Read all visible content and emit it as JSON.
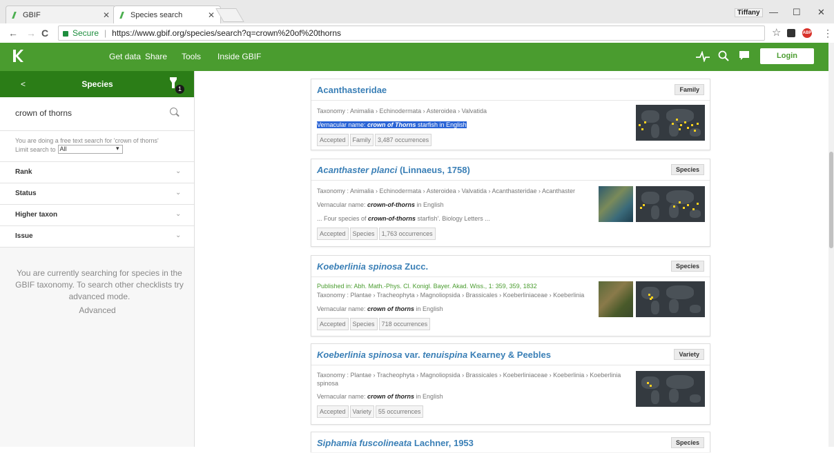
{
  "browser": {
    "tabs": [
      {
        "title": "GBIF"
      },
      {
        "title": "Species search"
      }
    ],
    "profile_name": "Tiffany",
    "window_controls": {
      "minimize": "—",
      "maximize": "☐",
      "close": "✕"
    },
    "nav": {
      "back": "←",
      "forward": "→",
      "reload": "C"
    },
    "security_label": "Secure",
    "url": "https://www.gbif.org/species/search?q=crown%20of%20thorns",
    "extension_abp": "ABP"
  },
  "gbif_nav": {
    "items": [
      "Get data",
      "Share",
      "Tools",
      "Inside GBIF"
    ],
    "login_label": "Login",
    "brand_color": "#4a9c2f"
  },
  "sidebar": {
    "back": "<",
    "title": "Species",
    "filter_count": "1",
    "search_value": "crown of thorns",
    "freetext_note": "You are doing a free text search for 'crown of thorns'",
    "limit_label": "Limit search to",
    "limit_value": "All",
    "facets": [
      "Rank",
      "Status",
      "Higher taxon",
      "Issue"
    ],
    "info_text": "You are currently searching for species in the GBIF taxonomy. To search other checklists try advanced mode.",
    "advanced_label": "Advanced"
  },
  "results": [
    {
      "name": "Acanthasteridae",
      "author": "",
      "rank": "Family",
      "published": "",
      "taxonomy": "Taxonomy : Animalia › Echinodermata › Asteroidea › Valvatida",
      "vernacular_prefix": "Vernacular name: ",
      "vernacular_name": "crown of Thorns",
      "vernacular_suffix": " starfish in English",
      "snippet_prefix": "",
      "snippet_bold": "",
      "snippet_suffix": "",
      "status": "Accepted",
      "rank_chip": "Family",
      "occurrences": "3,487 occurrences"
    },
    {
      "name": "Acanthaster planci",
      "author": "(Linnaeus, 1758)",
      "rank": "Species",
      "published": "",
      "taxonomy": "Taxonomy : Animalia › Echinodermata › Asteroidea › Valvatida › Acanthasteridae › Acanthaster",
      "vernacular_prefix": "Vernacular name: ",
      "vernacular_name": "crown-of-thorns",
      "vernacular_suffix": " in English",
      "snippet_prefix": "... Four species of ",
      "snippet_bold": "crown-of-thorns",
      "snippet_suffix": " starfish'. Biology Letters ...",
      "status": "Accepted",
      "rank_chip": "Species",
      "occurrences": "1,763 occurrences"
    },
    {
      "name": "Koeberlinia spinosa",
      "author": "Zucc.",
      "rank": "Species",
      "published": "Published in: Abh. Math.-Phys. Cl. Konigl. Bayer. Akad. Wiss., 1: 359, 359, 1832",
      "taxonomy": "Taxonomy : Plantae › Tracheophyta › Magnoliopsida › Brassicales › Koeberliniaceae › Koeberlinia",
      "vernacular_prefix": "Vernacular name: ",
      "vernacular_name": "crown of thorns",
      "vernacular_suffix": " in English",
      "snippet_prefix": "",
      "snippet_bold": "",
      "snippet_suffix": "",
      "status": "Accepted",
      "rank_chip": "Species",
      "occurrences": "718 occurrences"
    },
    {
      "name": "Koeberlinia spinosa",
      "name_var": "var.",
      "name_infra": "tenuispina",
      "author": "Kearney & Peebles",
      "rank": "Variety",
      "published": "",
      "taxonomy": "Taxonomy : Plantae › Tracheophyta › Magnoliopsida › Brassicales › Koeberliniaceae › Koeberlinia › Koeberlinia",
      "taxonomy_cont": "spinosa",
      "vernacular_prefix": "Vernacular name: ",
      "vernacular_name": "crown of thorns",
      "vernacular_suffix": " in English",
      "snippet_prefix": "",
      "snippet_bold": "",
      "snippet_suffix": "",
      "status": "Accepted",
      "rank_chip": "Variety",
      "occurrences": "55 occurrences"
    },
    {
      "name": "Siphamia fuscolineata",
      "author": "Lachner, 1953",
      "rank": "Species"
    }
  ]
}
